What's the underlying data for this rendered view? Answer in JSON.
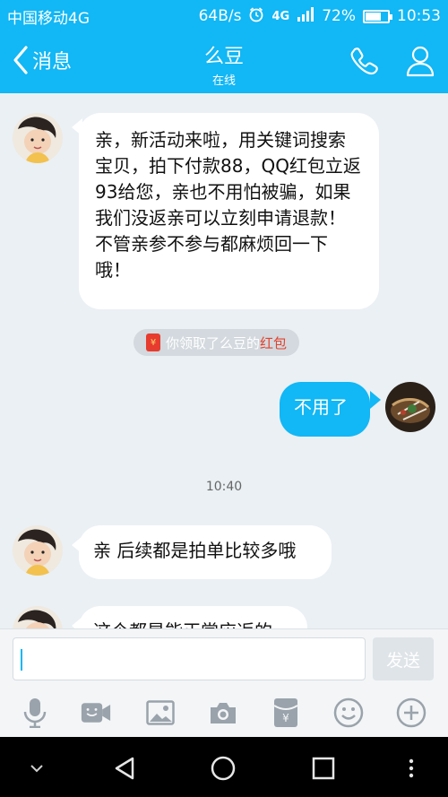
{
  "status_bar": {
    "carrier": "中国移动4G",
    "speed": "64B/s",
    "network": "4G",
    "battery": "72%",
    "battery_level": 0.72,
    "time": "10:53"
  },
  "header": {
    "back_label": "消息",
    "title": "么豆",
    "subtitle": "在线"
  },
  "messages": [
    {
      "text": "亲，新活动来啦，用关键词搜索宝贝，拍下付款88，QQ红包立返93给您，亲也不用怕被骗，如果我们没返亲可以立刻申请退款！不管亲参不参与都麻烦回一下哦！"
    },
    {
      "text": "不用了"
    },
    {
      "text": "亲 后续都是拍单比较多哦"
    },
    {
      "text": "这个都是能正常应返的"
    }
  ],
  "notice": {
    "prefix": "你领取了么豆的",
    "link": "红包",
    "icon": "red-envelope-icon"
  },
  "time_label": "10:40",
  "input": {
    "value": "",
    "send_label": "发送"
  },
  "toolbar": [
    "microphone-icon",
    "video-icon",
    "image-icon",
    "camera-icon",
    "red-envelope-icon",
    "emoji-icon",
    "plus-icon"
  ],
  "colors": {
    "brand": "#12b7f5",
    "bubble_in": "#ffffff",
    "bubble_out": "#12b7f5",
    "background": "#eaf0f4",
    "red_envelope": "#e63b2e"
  }
}
